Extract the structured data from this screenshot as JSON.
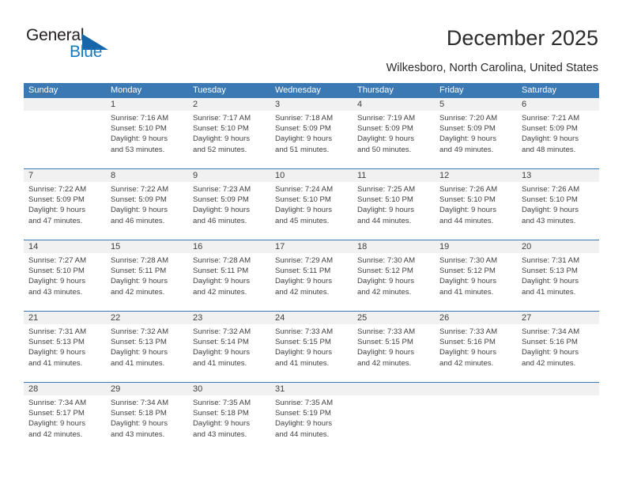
{
  "brand": {
    "name_top": "General",
    "name_bottom": "Blue",
    "color_dark": "#231f20",
    "color_blue": "#1878be",
    "triangle_color": "#1565a8"
  },
  "header": {
    "title": "December 2025",
    "subtitle": "Wilkesboro, North Carolina, United States",
    "accent_color": "#3b79b5",
    "daynum_band_color": "#f1f1f1"
  },
  "calendar": {
    "weekday_headers": [
      "Sunday",
      "Monday",
      "Tuesday",
      "Wednesday",
      "Thursday",
      "Friday",
      "Saturday"
    ],
    "weeks": [
      [
        {
          "day": "",
          "lines": []
        },
        {
          "day": "1",
          "lines": [
            "Sunrise: 7:16 AM",
            "Sunset: 5:10 PM",
            "Daylight: 9 hours",
            "and 53 minutes."
          ]
        },
        {
          "day": "2",
          "lines": [
            "Sunrise: 7:17 AM",
            "Sunset: 5:10 PM",
            "Daylight: 9 hours",
            "and 52 minutes."
          ]
        },
        {
          "day": "3",
          "lines": [
            "Sunrise: 7:18 AM",
            "Sunset: 5:09 PM",
            "Daylight: 9 hours",
            "and 51 minutes."
          ]
        },
        {
          "day": "4",
          "lines": [
            "Sunrise: 7:19 AM",
            "Sunset: 5:09 PM",
            "Daylight: 9 hours",
            "and 50 minutes."
          ]
        },
        {
          "day": "5",
          "lines": [
            "Sunrise: 7:20 AM",
            "Sunset: 5:09 PM",
            "Daylight: 9 hours",
            "and 49 minutes."
          ]
        },
        {
          "day": "6",
          "lines": [
            "Sunrise: 7:21 AM",
            "Sunset: 5:09 PM",
            "Daylight: 9 hours",
            "and 48 minutes."
          ]
        }
      ],
      [
        {
          "day": "7",
          "lines": [
            "Sunrise: 7:22 AM",
            "Sunset: 5:09 PM",
            "Daylight: 9 hours",
            "and 47 minutes."
          ]
        },
        {
          "day": "8",
          "lines": [
            "Sunrise: 7:22 AM",
            "Sunset: 5:09 PM",
            "Daylight: 9 hours",
            "and 46 minutes."
          ]
        },
        {
          "day": "9",
          "lines": [
            "Sunrise: 7:23 AM",
            "Sunset: 5:09 PM",
            "Daylight: 9 hours",
            "and 46 minutes."
          ]
        },
        {
          "day": "10",
          "lines": [
            "Sunrise: 7:24 AM",
            "Sunset: 5:10 PM",
            "Daylight: 9 hours",
            "and 45 minutes."
          ]
        },
        {
          "day": "11",
          "lines": [
            "Sunrise: 7:25 AM",
            "Sunset: 5:10 PM",
            "Daylight: 9 hours",
            "and 44 minutes."
          ]
        },
        {
          "day": "12",
          "lines": [
            "Sunrise: 7:26 AM",
            "Sunset: 5:10 PM",
            "Daylight: 9 hours",
            "and 44 minutes."
          ]
        },
        {
          "day": "13",
          "lines": [
            "Sunrise: 7:26 AM",
            "Sunset: 5:10 PM",
            "Daylight: 9 hours",
            "and 43 minutes."
          ]
        }
      ],
      [
        {
          "day": "14",
          "lines": [
            "Sunrise: 7:27 AM",
            "Sunset: 5:10 PM",
            "Daylight: 9 hours",
            "and 43 minutes."
          ]
        },
        {
          "day": "15",
          "lines": [
            "Sunrise: 7:28 AM",
            "Sunset: 5:11 PM",
            "Daylight: 9 hours",
            "and 42 minutes."
          ]
        },
        {
          "day": "16",
          "lines": [
            "Sunrise: 7:28 AM",
            "Sunset: 5:11 PM",
            "Daylight: 9 hours",
            "and 42 minutes."
          ]
        },
        {
          "day": "17",
          "lines": [
            "Sunrise: 7:29 AM",
            "Sunset: 5:11 PM",
            "Daylight: 9 hours",
            "and 42 minutes."
          ]
        },
        {
          "day": "18",
          "lines": [
            "Sunrise: 7:30 AM",
            "Sunset: 5:12 PM",
            "Daylight: 9 hours",
            "and 42 minutes."
          ]
        },
        {
          "day": "19",
          "lines": [
            "Sunrise: 7:30 AM",
            "Sunset: 5:12 PM",
            "Daylight: 9 hours",
            "and 41 minutes."
          ]
        },
        {
          "day": "20",
          "lines": [
            "Sunrise: 7:31 AM",
            "Sunset: 5:13 PM",
            "Daylight: 9 hours",
            "and 41 minutes."
          ]
        }
      ],
      [
        {
          "day": "21",
          "lines": [
            "Sunrise: 7:31 AM",
            "Sunset: 5:13 PM",
            "Daylight: 9 hours",
            "and 41 minutes."
          ]
        },
        {
          "day": "22",
          "lines": [
            "Sunrise: 7:32 AM",
            "Sunset: 5:13 PM",
            "Daylight: 9 hours",
            "and 41 minutes."
          ]
        },
        {
          "day": "23",
          "lines": [
            "Sunrise: 7:32 AM",
            "Sunset: 5:14 PM",
            "Daylight: 9 hours",
            "and 41 minutes."
          ]
        },
        {
          "day": "24",
          "lines": [
            "Sunrise: 7:33 AM",
            "Sunset: 5:15 PM",
            "Daylight: 9 hours",
            "and 41 minutes."
          ]
        },
        {
          "day": "25",
          "lines": [
            "Sunrise: 7:33 AM",
            "Sunset: 5:15 PM",
            "Daylight: 9 hours",
            "and 42 minutes."
          ]
        },
        {
          "day": "26",
          "lines": [
            "Sunrise: 7:33 AM",
            "Sunset: 5:16 PM",
            "Daylight: 9 hours",
            "and 42 minutes."
          ]
        },
        {
          "day": "27",
          "lines": [
            "Sunrise: 7:34 AM",
            "Sunset: 5:16 PM",
            "Daylight: 9 hours",
            "and 42 minutes."
          ]
        }
      ],
      [
        {
          "day": "28",
          "lines": [
            "Sunrise: 7:34 AM",
            "Sunset: 5:17 PM",
            "Daylight: 9 hours",
            "and 42 minutes."
          ]
        },
        {
          "day": "29",
          "lines": [
            "Sunrise: 7:34 AM",
            "Sunset: 5:18 PM",
            "Daylight: 9 hours",
            "and 43 minutes."
          ]
        },
        {
          "day": "30",
          "lines": [
            "Sunrise: 7:35 AM",
            "Sunset: 5:18 PM",
            "Daylight: 9 hours",
            "and 43 minutes."
          ]
        },
        {
          "day": "31",
          "lines": [
            "Sunrise: 7:35 AM",
            "Sunset: 5:19 PM",
            "Daylight: 9 hours",
            "and 44 minutes."
          ]
        },
        {
          "day": "",
          "lines": []
        },
        {
          "day": "",
          "lines": []
        },
        {
          "day": "",
          "lines": []
        }
      ]
    ]
  }
}
